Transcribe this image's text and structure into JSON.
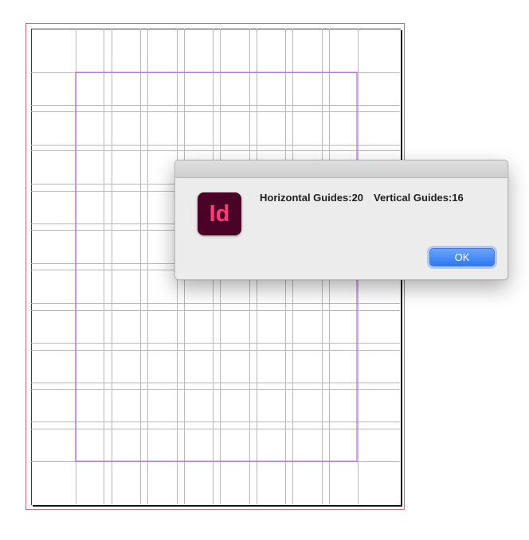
{
  "dialog": {
    "horizontal_label": "Horizontal Guides:",
    "horizontal_count": "20",
    "vertical_label": "Vertical Guides:",
    "vertical_count": "16",
    "ok_label": "OK"
  },
  "app_icon": {
    "text": "Id",
    "icon": "indesign-app-icon",
    "background": "#4a0326",
    "foreground": "#ff3b79"
  },
  "colors": {
    "bleed_line": "#e0607e",
    "margin_guide": "#b04ae0",
    "ruler_guide": "#b8b8b8",
    "ok_button": "#2f77f2"
  }
}
